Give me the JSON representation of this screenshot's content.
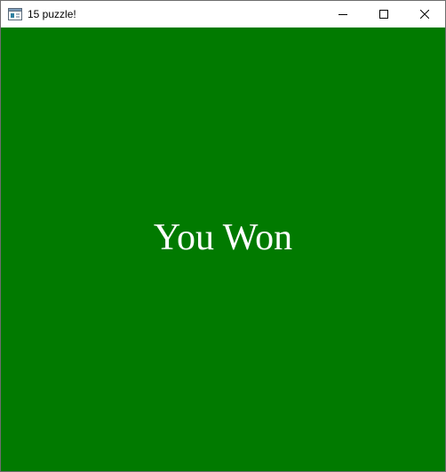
{
  "window": {
    "title": "15 puzzle!",
    "icon": "app-window-icon",
    "controls": {
      "minimize_icon": "minimize-icon",
      "maximize_icon": "maximize-icon",
      "close_icon": "close-icon"
    }
  },
  "game": {
    "message": "You Won",
    "background_color": "#017a00",
    "text_color": "#ffffff"
  }
}
